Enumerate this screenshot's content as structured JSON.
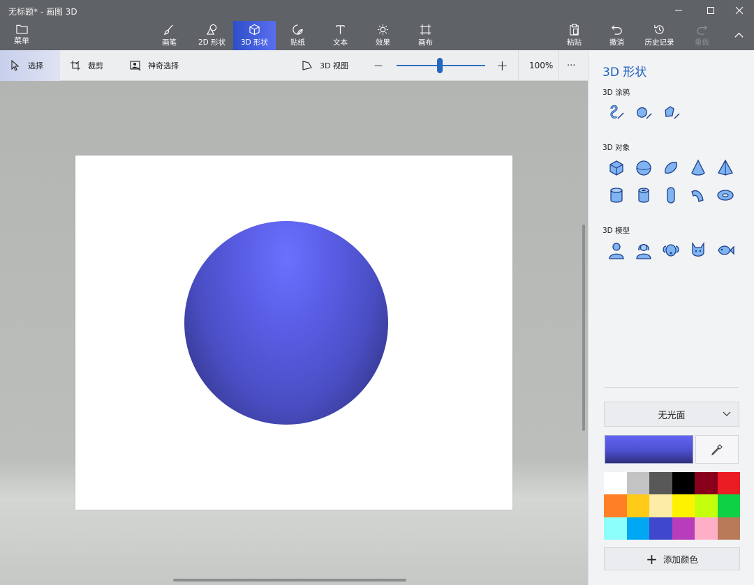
{
  "window": {
    "title": "无标题* - 画图 3D"
  },
  "menu": {
    "label": "菜单",
    "icon": "folder-icon"
  },
  "ribbon": {
    "tabs": [
      {
        "label": "画笔",
        "icon": "brush-icon"
      },
      {
        "label": "2D 形状",
        "icon": "2d-shapes-icon"
      },
      {
        "label": "3D 形状",
        "icon": "3d-shapes-icon",
        "active": true
      },
      {
        "label": "贴纸",
        "icon": "sticker-icon"
      },
      {
        "label": "文本",
        "icon": "text-icon"
      },
      {
        "label": "效果",
        "icon": "effects-icon"
      },
      {
        "label": "画布",
        "icon": "canvas-icon"
      }
    ],
    "actions": [
      {
        "label": "粘贴",
        "icon": "paste-icon"
      },
      {
        "label": "撤消",
        "icon": "undo-icon"
      },
      {
        "label": "历史记录",
        "icon": "history-icon"
      },
      {
        "label": "重做",
        "icon": "redo-icon",
        "disabled": true
      }
    ]
  },
  "toolbar": {
    "select": "选择",
    "crop": "裁剪",
    "magic_select": "神奇选择",
    "view_3d": "3D 视图",
    "zoom": "100%",
    "zoom_minus": "—",
    "zoom_plus": "+",
    "more": "···",
    "zoom_slider_position": 0.49
  },
  "panel": {
    "title": "3D 形状",
    "sections": {
      "doodles": "3D 涂鸦",
      "objects": "3D 对象",
      "models": "3D 模型"
    },
    "finish": "无光面",
    "add_color": "添加颜色",
    "palette": [
      "#ffffff",
      "#c3c3c3",
      "#585858",
      "#000000",
      "#88001b",
      "#ec1c24",
      "#ff7f27",
      "#ffca18",
      "#fdeca6",
      "#fff200",
      "#c4ff0e",
      "#0ed145",
      "#8cfffb",
      "#00a8f3",
      "#3f48cc",
      "#b83dba",
      "#ffaec8",
      "#b97a57"
    ]
  }
}
